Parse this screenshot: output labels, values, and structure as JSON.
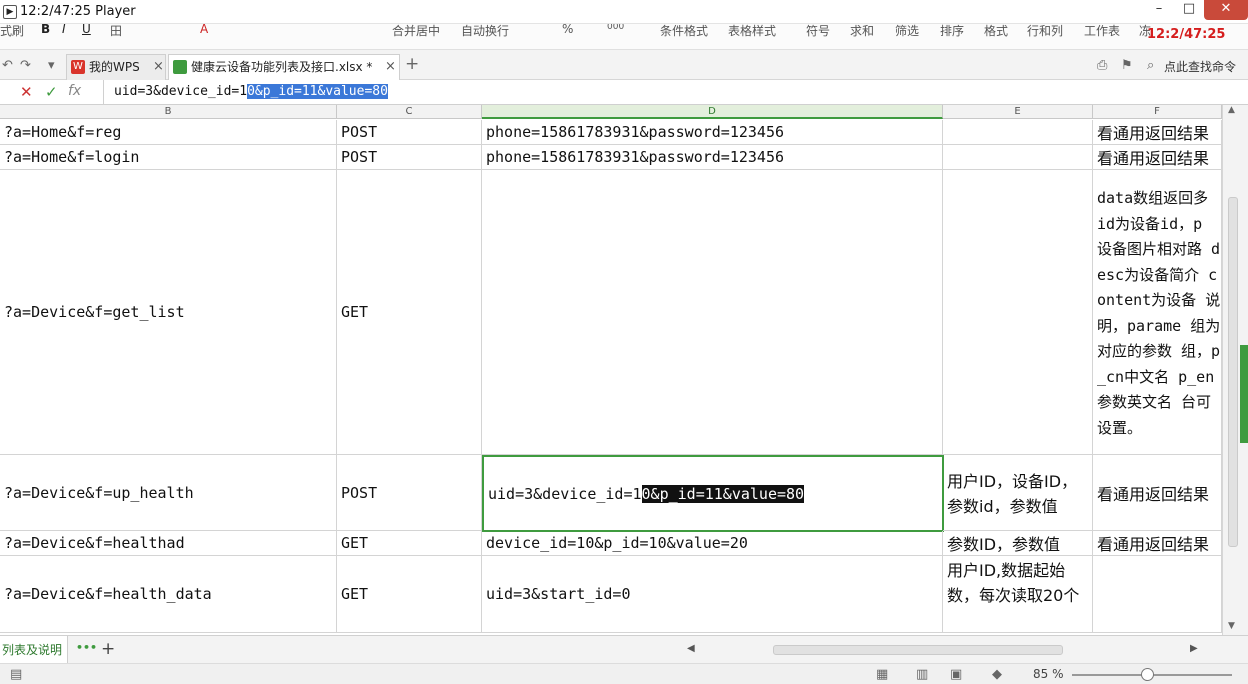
{
  "window": {
    "title": "12:2/47:25 Player",
    "min_glyph": "–",
    "max_glyph": "□",
    "close_glyph": "✕"
  },
  "ribbon": {
    "items": [
      "式刷",
      "B",
      "I",
      "U",
      "田",
      "A",
      "合并居中",
      "自动换行",
      "%",
      "000",
      "条件格式",
      "表格样式",
      "符号",
      "求和",
      "筛选",
      "排序",
      "格式",
      "行和列",
      "工作表",
      "冻"
    ],
    "time_overlay": "12:2/47:25"
  },
  "tabs": {
    "wps_label": "我的WPS",
    "file_label": "健康云设备功能列表及接口.xlsx *",
    "add_glyph": "+",
    "close_glyph": "×",
    "search_label": "点此查找命令"
  },
  "formula_bar": {
    "prefix": "uid=3&device_id=1",
    "selected": "0&p_id=11&value=80",
    "cancel_glyph": "✕",
    "confirm_glyph": "✓",
    "fx_glyph": "fx"
  },
  "columns": [
    "B",
    "C",
    "D",
    "E",
    "F"
  ],
  "rows": [
    {
      "b": "?a=Home&f=reg",
      "c": "POST",
      "d": "phone=15861783931&password=123456",
      "e": "",
      "f": "看通用返回结果"
    },
    {
      "b": "?a=Home&f=login",
      "c": "POST",
      "d": "phone=15861783931&password=123456",
      "e": "",
      "f": "看通用返回结果"
    },
    {
      "b": "?a=Device&f=get_list",
      "c": "GET",
      "d": "",
      "e": "",
      "f": "data数组返回多 id为设备id，p 设备图片相对路 desc为设备简介 content为设备 说明，parame 组为对应的参数 组，p_cn中文名 p_en参数英文名 台可设置。"
    },
    {
      "b": "?a=Device&f=up_health",
      "c": "POST",
      "d_prefix": "uid=3&device_id=1",
      "d_selected": "0&p_id=11&value=80",
      "e": "用户ID，设备ID，参数id，参数值",
      "f": "看通用返回结果"
    },
    {
      "b": "?a=Device&f=healthad",
      "c": "GET",
      "d": "device_id=10&p_id=10&value=20",
      "e": "参数ID，参数值",
      "f": "看通用返回结果"
    },
    {
      "b": "?a=Device&f=health_data",
      "c": "GET",
      "d": "uid=3&start_id=0",
      "e": "用户ID,数据起始数，每次读取20个",
      "f": ""
    }
  ],
  "sheet_tab": {
    "label": "列表及说明",
    "more_glyph": "•••",
    "add_glyph": "+"
  },
  "status": {
    "zoom": "85 %"
  }
}
